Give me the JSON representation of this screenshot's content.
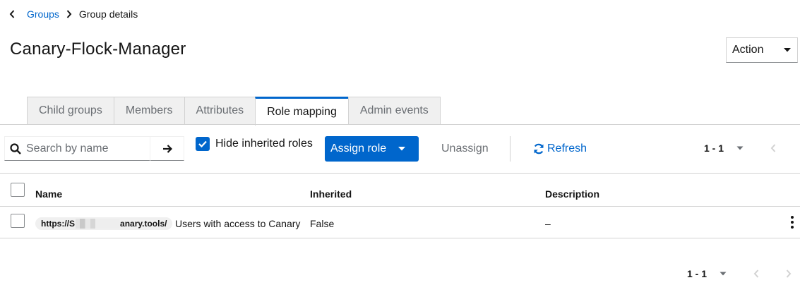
{
  "breadcrumb": {
    "back_icon": "chevron-left-icon",
    "parent": "Groups",
    "current": "Group details"
  },
  "page": {
    "title": "Canary-Flock-Manager"
  },
  "action_menu": {
    "label": "Action"
  },
  "tabs": [
    {
      "label": "Child groups",
      "active": false
    },
    {
      "label": "Members",
      "active": false
    },
    {
      "label": "Attributes",
      "active": false
    },
    {
      "label": "Role mapping",
      "active": true
    },
    {
      "label": "Admin events",
      "active": false
    }
  ],
  "toolbar": {
    "search_placeholder": "Search by name",
    "hide_inherited_label": "Hide inherited roles",
    "hide_inherited_checked": true,
    "assign_label": "Assign role",
    "unassign_label": "Unassign",
    "refresh_label": "Refresh"
  },
  "pagination_top": {
    "range": "1 - 1"
  },
  "pagination_bottom": {
    "range": "1 - 1"
  },
  "table": {
    "columns": [
      "Name",
      "Inherited",
      "Description"
    ],
    "rows": [
      {
        "client_prefix": "https://",
        "client_partial_1": "S",
        "client_suffix": "anary.tools/",
        "role_name": "Users with access to Canary",
        "inherited": "False",
        "description": "–"
      }
    ]
  },
  "colors": {
    "accent": "#0066cc",
    "border": "#d2d2d2",
    "muted_text": "#6a6e73",
    "tab_bg": "#f0f0f0"
  }
}
